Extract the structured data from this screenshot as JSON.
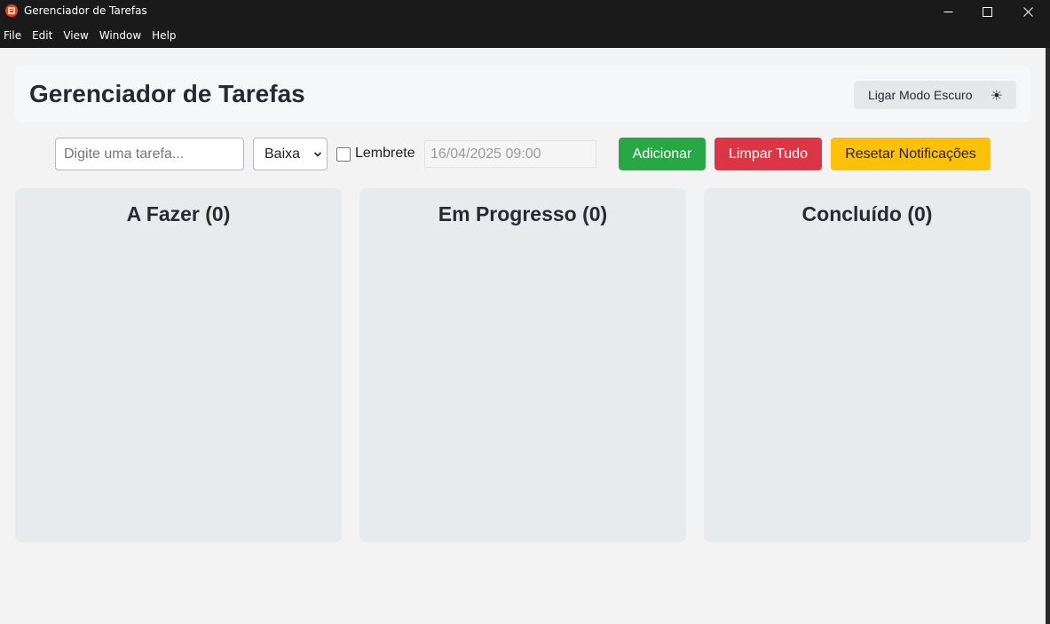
{
  "window": {
    "title": "Gerenciador de Tarefas",
    "controls": [
      "minimize-icon",
      "maximize-icon",
      "close-icon"
    ]
  },
  "menu": {
    "items": [
      "File",
      "Edit",
      "View",
      "Window",
      "Help"
    ]
  },
  "header": {
    "title": "Gerenciador de Tarefas",
    "dark_mode_label": "Ligar Modo Escuro",
    "dark_mode_icon": "☀"
  },
  "form": {
    "task_placeholder": "Digite uma tarefa...",
    "task_value": "",
    "priority_selected": "Baixa",
    "reminder_label": "Lembrete",
    "reminder_checked": false,
    "datetime_value": "16/04/2025 09:00",
    "add_label": "Adicionar",
    "clear_label": "Limpar Tudo",
    "reset_label": "Resetar Notificações"
  },
  "columns": [
    {
      "title": "A Fazer (0)"
    },
    {
      "title": "Em Progresso (0)"
    },
    {
      "title": "Concluído (0)"
    }
  ],
  "colors": {
    "add": "#28a745",
    "clear": "#dc3545",
    "reset": "#ffc107",
    "column_bg": "#e8ebee",
    "page_bg": "#f3f3f3"
  }
}
